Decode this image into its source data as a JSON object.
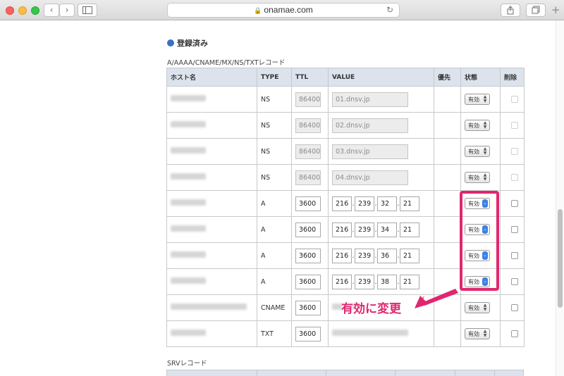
{
  "browser": {
    "url": "onamae.com",
    "colors": {
      "close": "#fc605c",
      "minimize": "#fdbc40",
      "zoom": "#34c84a"
    },
    "icons": [
      "back-icon",
      "forward-icon",
      "sidebar-icon",
      "lock-icon",
      "reload-icon",
      "share-icon",
      "tabs-icon",
      "new-tab-icon"
    ]
  },
  "section": {
    "title": "登録済み",
    "subtitle": "A/AAAA/CNAME/MX/NS/TXTレコード",
    "accent": "#3a6fc9"
  },
  "table": {
    "headers": {
      "host": "ホスト名",
      "type": "TYPE",
      "ttl": "TTL",
      "value": "VALUE",
      "priority": "優先",
      "status": "状態",
      "delete": "削除"
    },
    "rows": [
      {
        "type": "NS",
        "ttl": "86400",
        "value": "01.dnsv.jp",
        "status": "有効"
      },
      {
        "type": "NS",
        "ttl": "86400",
        "value": "02.dnsv.jp",
        "status": "有効"
      },
      {
        "type": "NS",
        "ttl": "86400",
        "value": "03.dnsv.jp",
        "status": "有効"
      },
      {
        "type": "NS",
        "ttl": "86400",
        "value": "04.dnsv.jp",
        "status": "有効"
      },
      {
        "type": "A",
        "ttl": "3600",
        "ip": [
          "216",
          "239",
          "32",
          "21"
        ],
        "status": "有効"
      },
      {
        "type": "A",
        "ttl": "3600",
        "ip": [
          "216",
          "239",
          "34",
          "21"
        ],
        "status": "有効"
      },
      {
        "type": "A",
        "ttl": "3600",
        "ip": [
          "216",
          "239",
          "36",
          "21"
        ],
        "status": "有効"
      },
      {
        "type": "A",
        "ttl": "3600",
        "ip": [
          "216",
          "239",
          "38",
          "21"
        ],
        "status": "有効"
      },
      {
        "type": "CNAME",
        "ttl": "3600",
        "status": "有効"
      },
      {
        "type": "TXT",
        "ttl": "3600",
        "status": "有効"
      }
    ]
  },
  "srv": {
    "title": "SRVレコード"
  },
  "annotation": {
    "text": "有効に変更",
    "color": "#e0266f"
  }
}
